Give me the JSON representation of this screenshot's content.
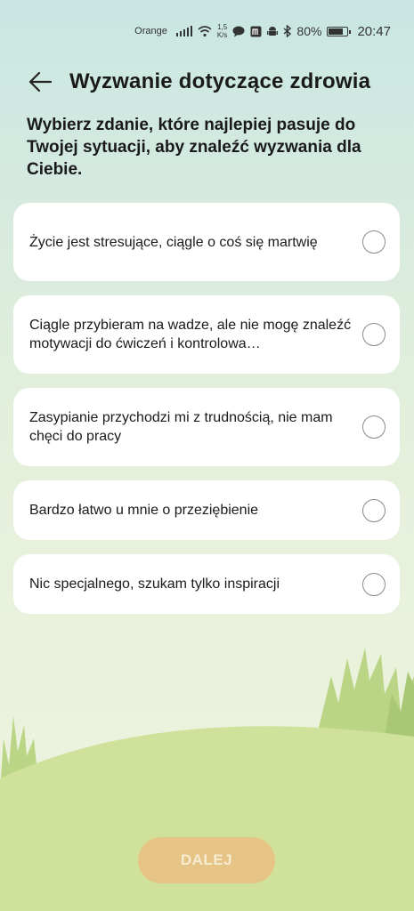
{
  "status_bar": {
    "carrier": "Orange",
    "speed_value": "1,5",
    "speed_unit": "K/s",
    "battery": "80%",
    "time": "20:47"
  },
  "header": {
    "title": "Wyzwanie dotyczące zdrowia"
  },
  "intro": "Wybierz zdanie, które najlepiej pasuje do Twojej sytuacji, aby znaleźć wyzwania dla Ciebie.",
  "options": [
    {
      "label": "Życie jest stresujące, ciągle o coś się martwię"
    },
    {
      "label": "Ciągle przybieram na wadze, ale nie mogę znaleźć motywacji do ćwiczeń i kontrolowa…"
    },
    {
      "label": "Zasypianie przychodzi mi z trudnością, nie mam chęci do pracy"
    },
    {
      "label": "Bardzo łatwo u mnie o przeziębienie"
    },
    {
      "label": "Nic specjalnego, szukam tylko inspiracji"
    }
  ],
  "next_button": "DALEJ",
  "colors": {
    "button": "#e6c485",
    "hill": "#cfe19a",
    "grass": "#b9d585"
  }
}
